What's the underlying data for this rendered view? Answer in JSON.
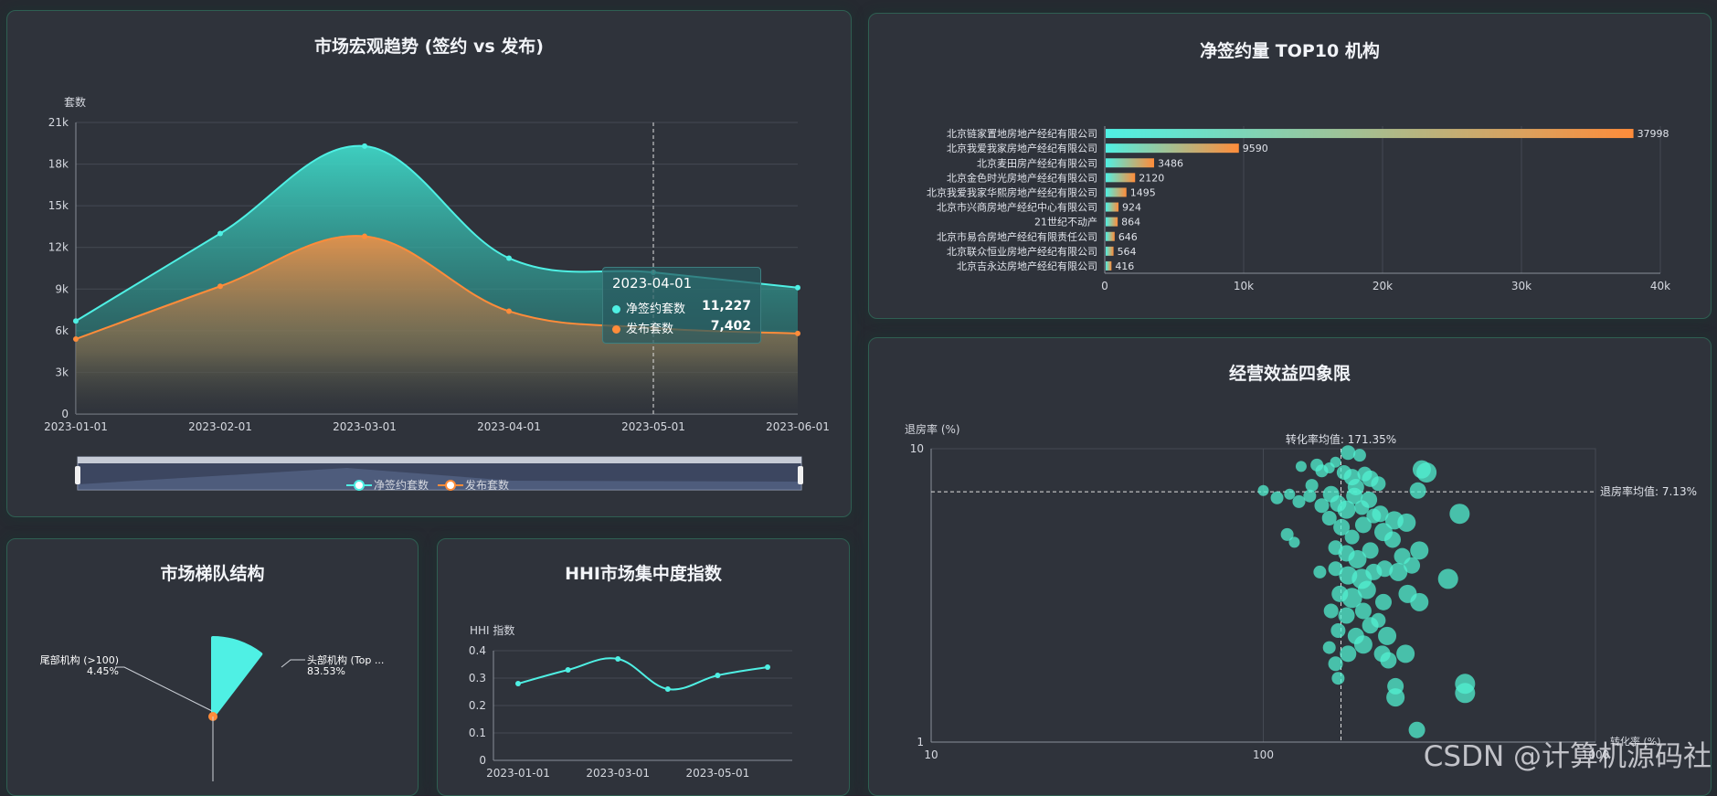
{
  "panels": {
    "trend": {
      "title": "市场宏观趋势 (签约 vs 发布)"
    },
    "top10": {
      "title": "净签约量 TOP10 机构"
    },
    "tier": {
      "title": "市场梯队结构"
    },
    "hhi": {
      "title": "HHI市场集中度指数"
    },
    "quadrant": {
      "title": "经营效益四象限"
    }
  },
  "tooltip": {
    "date": "2023-04-01",
    "rows": [
      {
        "label": "净签约套数",
        "value": "11,227",
        "color": "#4ff0e4"
      },
      {
        "label": "发布套数",
        "value": "7,402",
        "color": "#ff8c3a"
      }
    ]
  },
  "watermark": "CSDN @计算机源码社",
  "colors": {
    "cyan": "#4ff0e4",
    "orange": "#ff8c3a",
    "panel": "#2f333b",
    "border": "#2f5f52"
  },
  "chart_data": [
    {
      "id": "trend",
      "type": "area",
      "title": "市场宏观趋势 (签约 vs 发布)",
      "ylabel": "套数",
      "ylim": [
        0,
        21000
      ],
      "yticks": [
        0,
        3000,
        6000,
        9000,
        12000,
        15000,
        18000,
        21000
      ],
      "ytick_labels": [
        "0",
        "3k",
        "6k",
        "9k",
        "12k",
        "15k",
        "18k",
        "21k"
      ],
      "categories": [
        "2023-01-01",
        "2023-02-01",
        "2023-03-01",
        "2023-04-01",
        "2023-05-01",
        "2023-06-01"
      ],
      "series": [
        {
          "name": "净签约套数",
          "values": [
            6700,
            13000,
            19300,
            11227,
            10200,
            9100
          ]
        },
        {
          "name": "发布套数",
          "values": [
            5400,
            9200,
            12800,
            7402,
            6200,
            5800
          ]
        }
      ],
      "cursor_x": "2023-05-01",
      "grid": true,
      "legend": "bottom"
    },
    {
      "id": "top10",
      "type": "bar",
      "orientation": "horizontal",
      "title": "净签约量 TOP10 机构",
      "categories": [
        "北京链家置地房地产经纪有限公司",
        "北京我爱我家房地产经纪有限公司",
        "北京麦田房产经纪有限公司",
        "北京金色时光房地产经纪有限公司",
        "北京我爱我家华熙房地产经纪有限公司",
        "北京市兴商房地产经纪中心有限公司",
        "21世纪不动产",
        "北京市易合房地产经纪有限责任公司",
        "北京联众恒业房地产经纪有限公司",
        "北京吉永达房地产经纪有限公司"
      ],
      "values": [
        37998,
        9590,
        3486,
        2120,
        1495,
        924,
        864,
        646,
        564,
        416
      ],
      "value_labels": [
        "37998",
        "9590",
        "3486",
        "2120",
        "1495",
        "924",
        "864",
        "646",
        "564",
        "416"
      ],
      "xlim": [
        0,
        40000
      ],
      "xticks": [
        0,
        10000,
        20000,
        30000,
        40000
      ],
      "xtick_labels": [
        "0",
        "10k",
        "20k",
        "30k",
        "40k"
      ],
      "grid": true
    },
    {
      "id": "tier",
      "type": "pie",
      "title": "市场梯队结构",
      "slices": [
        {
          "name": "头部机构 (Top ...",
          "value": 83.53,
          "label": "83.53%",
          "color": "#4ff0e4"
        },
        {
          "name": "尾部机构 (>100)",
          "value": 4.45,
          "label": "4.45%",
          "color": "#ff8c3a"
        }
      ]
    },
    {
      "id": "hhi",
      "type": "line",
      "title": "HHI市场集中度指数",
      "ylabel": "HHI 指数",
      "ylim": [
        0,
        0.4
      ],
      "yticks": [
        0,
        0.1,
        0.2,
        0.3,
        0.4
      ],
      "ytick_labels": [
        "0",
        "0.1",
        "0.2",
        "0.3",
        "0.4"
      ],
      "categories": [
        "2023-01-01",
        "2023-02-01",
        "2023-03-01",
        "2023-04-01",
        "2023-05-01",
        "2023-06-01"
      ],
      "tick_labels": [
        "2023-01-01",
        "2023-03-01",
        "2023-05-01"
      ],
      "values": [
        0.28,
        0.33,
        0.37,
        0.26,
        0.31,
        0.34
      ],
      "grid": true
    },
    {
      "id": "quadrant",
      "type": "scatter",
      "title": "经营效益四象限",
      "ylabel": "退房率 (%)",
      "xlabel": "转化率 (%)",
      "x_scale": "log",
      "y_scale": "log",
      "xlim": [
        10,
        1000
      ],
      "ylim": [
        1,
        10
      ],
      "xticks": [
        10,
        100,
        1000
      ],
      "xtick_labels": [
        "10",
        "100",
        "1000"
      ],
      "yticks": [
        1,
        10
      ],
      "ytick_labels": [
        "1",
        "10"
      ],
      "mean_x": 171.35,
      "mean_y": 7.13,
      "mean_x_label": "转化率均值: 171.35%",
      "mean_y_label": "退房率均值: 7.13%",
      "points": [
        {
          "x": 180,
          "y": 9.7,
          "s": 8
        },
        {
          "x": 195,
          "y": 9.5,
          "s": 7
        },
        {
          "x": 165,
          "y": 9.0,
          "s": 6
        },
        {
          "x": 130,
          "y": 8.7,
          "s": 6
        },
        {
          "x": 145,
          "y": 8.8,
          "s": 7
        },
        {
          "x": 150,
          "y": 8.4,
          "s": 7
        },
        {
          "x": 158,
          "y": 8.6,
          "s": 6
        },
        {
          "x": 175,
          "y": 8.3,
          "s": 8
        },
        {
          "x": 185,
          "y": 8.0,
          "s": 9
        },
        {
          "x": 202,
          "y": 8.2,
          "s": 8
        },
        {
          "x": 210,
          "y": 7.9,
          "s": 9
        },
        {
          "x": 222,
          "y": 7.6,
          "s": 8
        },
        {
          "x": 300,
          "y": 8.5,
          "s": 10
        },
        {
          "x": 310,
          "y": 8.3,
          "s": 11
        },
        {
          "x": 100,
          "y": 7.2,
          "s": 6
        },
        {
          "x": 110,
          "y": 6.8,
          "s": 7
        },
        {
          "x": 120,
          "y": 7.0,
          "s": 6
        },
        {
          "x": 128,
          "y": 6.6,
          "s": 7
        },
        {
          "x": 138,
          "y": 6.9,
          "s": 7
        },
        {
          "x": 150,
          "y": 6.4,
          "s": 8
        },
        {
          "x": 160,
          "y": 7.0,
          "s": 9
        },
        {
          "x": 168,
          "y": 6.5,
          "s": 9
        },
        {
          "x": 178,
          "y": 6.2,
          "s": 10
        },
        {
          "x": 188,
          "y": 6.9,
          "s": 9
        },
        {
          "x": 198,
          "y": 6.3,
          "s": 8
        },
        {
          "x": 208,
          "y": 6.7,
          "s": 9
        },
        {
          "x": 225,
          "y": 6.0,
          "s": 9
        },
        {
          "x": 248,
          "y": 5.7,
          "s": 10
        },
        {
          "x": 292,
          "y": 7.2,
          "s": 9
        },
        {
          "x": 390,
          "y": 6.0,
          "s": 11
        },
        {
          "x": 158,
          "y": 5.8,
          "s": 8
        },
        {
          "x": 172,
          "y": 5.4,
          "s": 9
        },
        {
          "x": 185,
          "y": 5.0,
          "s": 8
        },
        {
          "x": 200,
          "y": 5.5,
          "s": 9
        },
        {
          "x": 230,
          "y": 5.2,
          "s": 10
        },
        {
          "x": 245,
          "y": 4.9,
          "s": 9
        },
        {
          "x": 270,
          "y": 5.6,
          "s": 10
        },
        {
          "x": 118,
          "y": 5.1,
          "s": 7
        },
        {
          "x": 124,
          "y": 4.8,
          "s": 6
        },
        {
          "x": 165,
          "y": 4.6,
          "s": 8
        },
        {
          "x": 178,
          "y": 4.4,
          "s": 9
        },
        {
          "x": 192,
          "y": 4.2,
          "s": 10
        },
        {
          "x": 210,
          "y": 4.5,
          "s": 9
        },
        {
          "x": 262,
          "y": 4.3,
          "s": 9
        },
        {
          "x": 295,
          "y": 4.5,
          "s": 10
        },
        {
          "x": 148,
          "y": 3.8,
          "s": 7
        },
        {
          "x": 165,
          "y": 3.9,
          "s": 8
        },
        {
          "x": 180,
          "y": 3.7,
          "s": 10
        },
        {
          "x": 198,
          "y": 3.6,
          "s": 11
        },
        {
          "x": 215,
          "y": 3.8,
          "s": 9
        },
        {
          "x": 232,
          "y": 3.9,
          "s": 9
        },
        {
          "x": 255,
          "y": 3.8,
          "s": 10
        },
        {
          "x": 280,
          "y": 4.0,
          "s": 9
        },
        {
          "x": 360,
          "y": 3.6,
          "s": 11
        },
        {
          "x": 170,
          "y": 3.2,
          "s": 9
        },
        {
          "x": 185,
          "y": 3.1,
          "s": 11
        },
        {
          "x": 205,
          "y": 3.3,
          "s": 10
        },
        {
          "x": 230,
          "y": 3.0,
          "s": 9
        },
        {
          "x": 272,
          "y": 3.2,
          "s": 10
        },
        {
          "x": 295,
          "y": 3.0,
          "s": 10
        },
        {
          "x": 160,
          "y": 2.8,
          "s": 8
        },
        {
          "x": 178,
          "y": 2.7,
          "s": 9
        },
        {
          "x": 200,
          "y": 2.8,
          "s": 9
        },
        {
          "x": 222,
          "y": 2.6,
          "s": 8
        },
        {
          "x": 168,
          "y": 2.4,
          "s": 8
        },
        {
          "x": 190,
          "y": 2.3,
          "s": 9
        },
        {
          "x": 210,
          "y": 2.5,
          "s": 9
        },
        {
          "x": 236,
          "y": 2.3,
          "s": 10
        },
        {
          "x": 158,
          "y": 2.1,
          "s": 7
        },
        {
          "x": 180,
          "y": 2.0,
          "s": 9
        },
        {
          "x": 200,
          "y": 2.15,
          "s": 10
        },
        {
          "x": 228,
          "y": 2.0,
          "s": 9
        },
        {
          "x": 268,
          "y": 2.0,
          "s": 10
        },
        {
          "x": 165,
          "y": 1.85,
          "s": 8
        },
        {
          "x": 238,
          "y": 1.9,
          "s": 9
        },
        {
          "x": 168,
          "y": 1.65,
          "s": 7
        },
        {
          "x": 250,
          "y": 1.55,
          "s": 9
        },
        {
          "x": 250,
          "y": 1.42,
          "s": 10
        },
        {
          "x": 405,
          "y": 1.58,
          "s": 11
        },
        {
          "x": 405,
          "y": 1.47,
          "s": 11
        },
        {
          "x": 290,
          "y": 1.1,
          "s": 9
        },
        {
          "x": 215,
          "y": 5.9,
          "s": 8
        },
        {
          "x": 190,
          "y": 7.4,
          "s": 9
        },
        {
          "x": 140,
          "y": 7.5,
          "s": 7
        }
      ]
    }
  ]
}
